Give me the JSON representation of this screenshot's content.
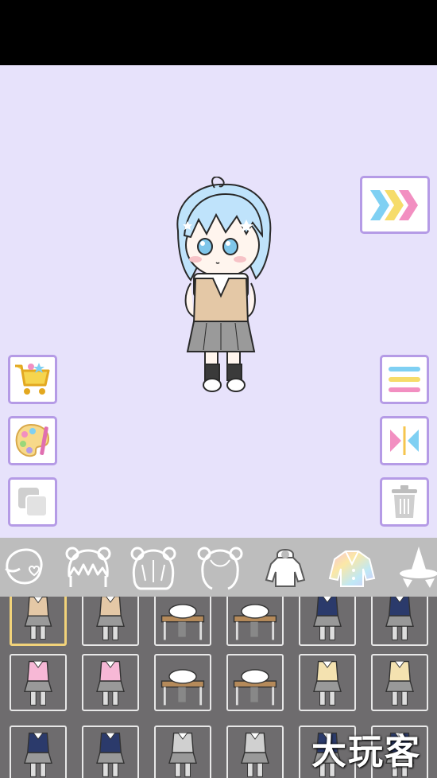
{
  "colors": {
    "stage_background": "#e7e2fb",
    "button_border": "#b59be6",
    "category_bar": "#bdbdbd",
    "grid_background": "#6e6c6e",
    "selected_border": "#f2d37a"
  },
  "stage": {
    "next_button_icon": "triple-chevron-icon",
    "left_buttons": [
      "shop-cart-icon",
      "palette-icon",
      "layers-icon"
    ],
    "right_buttons": [
      "menu-icon",
      "flip-icon",
      "trash-icon"
    ]
  },
  "categories": [
    {
      "icon": "face-icon",
      "selected": false
    },
    {
      "icon": "hair-front-icon",
      "selected": false
    },
    {
      "icon": "hair-back-icon",
      "selected": false
    },
    {
      "icon": "hair-side-icon",
      "selected": false
    },
    {
      "icon": "hoodie-icon",
      "selected": false
    },
    {
      "icon": "outfit-icon",
      "selected": true
    },
    {
      "icon": "hat-icon",
      "selected": false
    }
  ],
  "outfit_items": {
    "rows": 3,
    "columns": 6,
    "selected_index": 0
  },
  "watermark": {
    "text": "大玩客"
  }
}
